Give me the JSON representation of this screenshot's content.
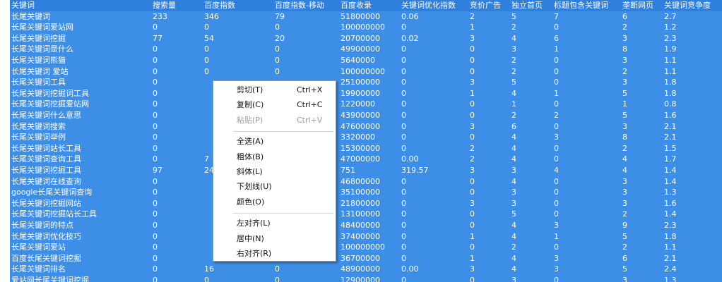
{
  "columns": [
    "关键词",
    "搜索量",
    "百度指数",
    "百度指数-移动",
    "百度收录",
    "关键词优化指数",
    "竞价广告",
    "独立首页",
    "标题包含关键词",
    "垄断网页",
    "关键词竞争度"
  ],
  "rows": [
    [
      "长尾关键词",
      "233",
      "346",
      "79",
      "51800000",
      "0.06",
      "2",
      "5",
      "7",
      "6",
      "2.7"
    ],
    [
      "长尾关键词爱站网",
      "0",
      "0",
      "0",
      "100000000",
      "0",
      "1",
      "2",
      "0",
      "2",
      "1.2"
    ],
    [
      "长尾关键词挖掘",
      "77",
      "54",
      "20",
      "20700000",
      "0.02",
      "3",
      "4",
      "6",
      "3",
      "2.3"
    ],
    [
      "长尾关键词是什么",
      "0",
      "0",
      "0",
      "49900000",
      "0",
      "0",
      "3",
      "1",
      "8",
      "1.9"
    ],
    [
      "长尾关键词熊猫",
      "0",
      "0",
      "0",
      "5640000",
      "0",
      "0",
      "2",
      "0",
      "3",
      "1.1"
    ],
    [
      "长尾关键词 爱站",
      "0",
      "0",
      "0",
      "100000000",
      "0",
      "0",
      "2",
      "0",
      "2",
      "1.1"
    ],
    [
      "长尾关键词工具",
      "0",
      "",
      "",
      "25100000",
      "0",
      "3",
      "5",
      "0",
      "3",
      "1.8"
    ],
    [
      "长尾关键词挖掘词工具",
      "0",
      "",
      "",
      "19900000",
      "0",
      "1",
      "4",
      "1",
      "5",
      "1.8"
    ],
    [
      "长尾关键词挖掘爱站网",
      "0",
      "",
      "",
      "1220000",
      "0",
      "0",
      "1",
      "0",
      "1",
      "0.8"
    ],
    [
      "长尾关键词什么意思",
      "0",
      "",
      "",
      "43900000",
      "0",
      "0",
      "2",
      "2",
      "5",
      "1.6"
    ],
    [
      "长尾关键词搜索",
      "0",
      "",
      "",
      "47600000",
      "0",
      "3",
      "6",
      "0",
      "3",
      "2.1"
    ],
    [
      "长尾关键词举例",
      "0",
      "",
      "",
      "3320000",
      "0",
      "0",
      "4",
      "3",
      "8",
      "2.1"
    ],
    [
      "长尾关键词站长工具",
      "0",
      "",
      "",
      "15300000",
      "0",
      "2",
      "4",
      "0",
      "2",
      "1.5"
    ],
    [
      "长尾关键词查询工具",
      "0",
      "7",
      "",
      "47000000",
      "0.00",
      "2",
      "4",
      "0",
      "4",
      "1.7"
    ],
    [
      "长尾关键词挖掘工具",
      "97",
      "24",
      "",
      "751",
      "319.57",
      "3",
      "3",
      "4",
      "4",
      "1.4"
    ],
    [
      "长尾关键词在线查询",
      "0",
      "",
      "",
      "46800000",
      "0",
      "0",
      "4",
      "0",
      "3",
      "1.4"
    ],
    [
      "google长尾关键词查询",
      "0",
      "",
      "",
      "35100000",
      "0",
      "0",
      "3",
      "0",
      "3",
      "1.3"
    ],
    [
      "长尾关键词挖掘网站",
      "0",
      "",
      "",
      "21800000",
      "0",
      "3",
      "3",
      "0",
      "3",
      "1.6"
    ],
    [
      "长尾关键词挖掘站长工具",
      "0",
      "",
      "",
      "13100000",
      "0",
      "0",
      "5",
      "0",
      "2",
      "1.4"
    ],
    [
      "长尾关键词的特点",
      "0",
      "",
      "",
      "48400000",
      "0",
      "0",
      "4",
      "3",
      "9",
      "2.3"
    ],
    [
      "长尾关键词优化技巧",
      "0",
      "",
      "",
      "37400000",
      "0",
      "1",
      "4",
      "1",
      "5",
      "1.8"
    ],
    [
      "长尾关键词爱站",
      "0",
      "",
      "",
      "100000000",
      "0",
      "0",
      "2",
      "0",
      "2",
      "1.1"
    ],
    [
      "百度长尾关键词挖掘",
      "0",
      "",
      "",
      "36700000",
      "0",
      "1",
      "4",
      "3",
      "6",
      "2.1"
    ],
    [
      "长尾关键词排名",
      "0",
      "16",
      "0",
      "48900000",
      "0.00",
      "3",
      "4",
      "3",
      "5",
      "2.4"
    ],
    [
      "爱站网长尾关键词挖掘",
      "0",
      "0",
      "0",
      "12900000",
      "0",
      "0",
      "3",
      "0",
      "3",
      "1.3"
    ]
  ],
  "context_menu": {
    "items": [
      {
        "label": "剪切(T)",
        "shortcut": "Ctrl+X",
        "disabled": false
      },
      {
        "label": "复制(C)",
        "shortcut": "Ctrl+C",
        "disabled": false
      },
      {
        "label": "粘贴(P)",
        "shortcut": "Ctrl+V",
        "disabled": true
      },
      {
        "separator": true
      },
      {
        "label": "全选(A)",
        "shortcut": "",
        "disabled": false
      },
      {
        "label": "粗体(B)",
        "shortcut": "",
        "disabled": false
      },
      {
        "label": "斜体(L)",
        "shortcut": "",
        "disabled": false
      },
      {
        "label": "下划线(U)",
        "shortcut": "",
        "disabled": false
      },
      {
        "label": "颜色(O)",
        "shortcut": "",
        "disabled": false
      },
      {
        "separator": true
      },
      {
        "label": "左对齐(L)",
        "shortcut": "",
        "disabled": false
      },
      {
        "label": "居中(N)",
        "shortcut": "",
        "disabled": false
      },
      {
        "label": "右对齐(R)",
        "shortcut": "",
        "disabled": false
      }
    ]
  },
  "colors": {
    "selection": "#3c8ee6",
    "header": "#2f7fdc",
    "text": "#ffffff",
    "menu_bg": "#ffffff",
    "menu_disabled": "#9a9a9a"
  }
}
